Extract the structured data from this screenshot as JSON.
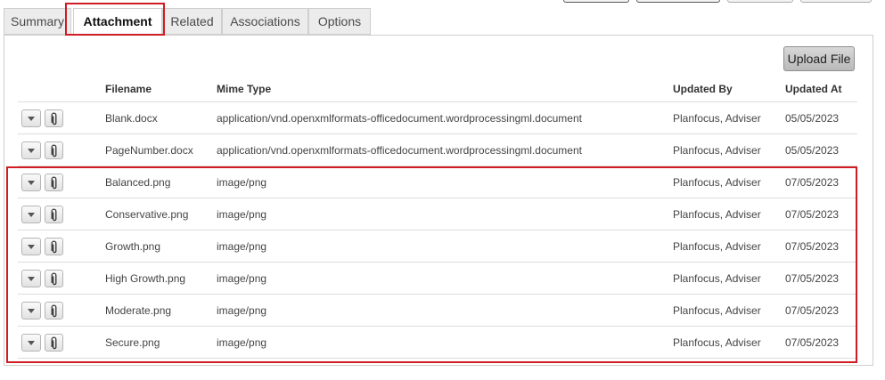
{
  "tabs": [
    {
      "label": "Summary"
    },
    {
      "label": "Attachment"
    },
    {
      "label": "Related"
    },
    {
      "label": "Associations"
    },
    {
      "label": "Options"
    }
  ],
  "active_tab": "Attachment",
  "toolbar": {
    "upload_label": "Upload File"
  },
  "table": {
    "columns": {
      "filename": "Filename",
      "mime": "Mime Type",
      "updated_by": "Updated By",
      "updated_at": "Updated At"
    },
    "rows": [
      {
        "filename": "Blank.docx",
        "mime": "application/vnd.openxmlformats-officedocument.wordprocessingml.document",
        "updated_by": "Planfocus, Adviser",
        "updated_at": "05/05/2023"
      },
      {
        "filename": "PageNumber.docx",
        "mime": "application/vnd.openxmlformats-officedocument.wordprocessingml.document",
        "updated_by": "Planfocus, Adviser",
        "updated_at": "05/05/2023"
      },
      {
        "filename": "Balanced.png",
        "mime": "image/png",
        "updated_by": "Planfocus, Adviser",
        "updated_at": "07/05/2023"
      },
      {
        "filename": "Conservative.png",
        "mime": "image/png",
        "updated_by": "Planfocus, Adviser",
        "updated_at": "07/05/2023"
      },
      {
        "filename": "Growth.png",
        "mime": "image/png",
        "updated_by": "Planfocus, Adviser",
        "updated_at": "07/05/2023"
      },
      {
        "filename": "High Growth.png",
        "mime": "image/png",
        "updated_by": "Planfocus, Adviser",
        "updated_at": "07/05/2023"
      },
      {
        "filename": "Moderate.png",
        "mime": "image/png",
        "updated_by": "Planfocus, Adviser",
        "updated_at": "07/05/2023"
      },
      {
        "filename": "Secure.png",
        "mime": "image/png",
        "updated_by": "Planfocus, Adviser",
        "updated_at": "07/05/2023"
      }
    ]
  },
  "icons": {
    "row_menu": "chevron-down-icon",
    "row_attachment": "paperclip-icon"
  },
  "colors": {
    "highlight": "#d01c24",
    "tab_bg": "#ececec",
    "border": "#cfcfcf"
  }
}
